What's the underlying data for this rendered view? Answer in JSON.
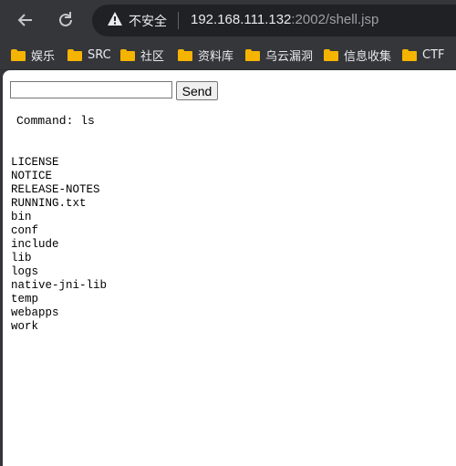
{
  "browser": {
    "back_icon": "back-arrow-icon",
    "reload_icon": "reload-icon",
    "security_label": "不安全",
    "url_host": "192.168.111.132",
    "url_path": ":2002/shell.jsp"
  },
  "bookmarks": [
    {
      "label": "娱乐"
    },
    {
      "label": "SRC"
    },
    {
      "label": "社区"
    },
    {
      "label": "资料库"
    },
    {
      "label": "乌云漏洞"
    },
    {
      "label": "信息收集"
    },
    {
      "label": "CTF"
    }
  ],
  "page": {
    "input_value": "",
    "send_label": "Send",
    "command_text": "Command: ls",
    "output_lines": [
      "LICENSE",
      "NOTICE",
      "RELEASE-NOTES",
      "RUNNING.txt",
      "bin",
      "conf",
      "include",
      "lib",
      "logs",
      "native-jni-lib",
      "temp",
      "webapps",
      "work"
    ]
  },
  "colors": {
    "chrome_bg": "#35363a",
    "omnibox_bg": "#202124",
    "folder": "#f5b400",
    "page_bg": "#ffffff"
  }
}
